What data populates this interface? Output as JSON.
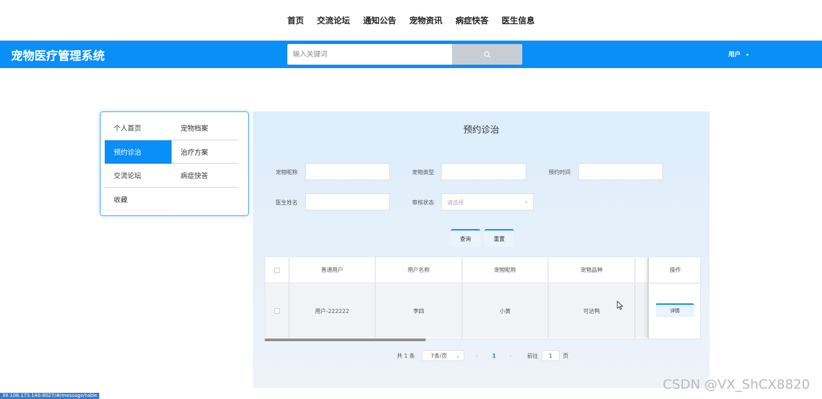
{
  "nav": [
    "首页",
    "交流论坛",
    "通知公告",
    "宠物资讯",
    "病症快答",
    "医生信息"
  ],
  "header": {
    "title": "宠物医疗管理系统",
    "search_placeholder": "输入关键词",
    "search_icon": "search-icon",
    "user_label": "用户",
    "user_caret": "▾"
  },
  "sidebar": {
    "items": [
      "个人首页",
      "宠物档案",
      "预约诊治",
      "治疗方案",
      "交流论坛",
      "病症快答",
      "收藏"
    ],
    "active": "预约诊治"
  },
  "main": {
    "title": "预约诊治",
    "filters": {
      "pet_name_label": "宠物昵称",
      "pet_type_label": "宠物类型",
      "appt_time_label": "预约时间",
      "doctor_name_label": "医生姓名",
      "review_status_label": "审核状态",
      "review_status_placeholder": "请选择"
    },
    "buttons": {
      "query": "查询",
      "reset": "重置"
    },
    "table": {
      "headers": [
        "普通用户",
        "用户名称",
        "宠物昵称",
        "宠物品种"
      ],
      "op_header": "操作",
      "rows": [
        {
          "user": "用户-222222",
          "name": "李四",
          "pet": "小黄",
          "breed": "可达鸭",
          "action": "详情"
        }
      ]
    },
    "pagination": {
      "total": "共 1 条",
      "page_size": "7条/页",
      "prev": "‹",
      "current": "1",
      "next": "›",
      "goto_label": "前往",
      "goto_value": "1",
      "page_unit": "页"
    }
  },
  "watermark": "CSDN @VX_ShCX8820",
  "status_url": "39.108.173.140:8027/#/message/table",
  "colors": {
    "accent": "#0a8ef7",
    "search_button": "#c8cdd3"
  }
}
